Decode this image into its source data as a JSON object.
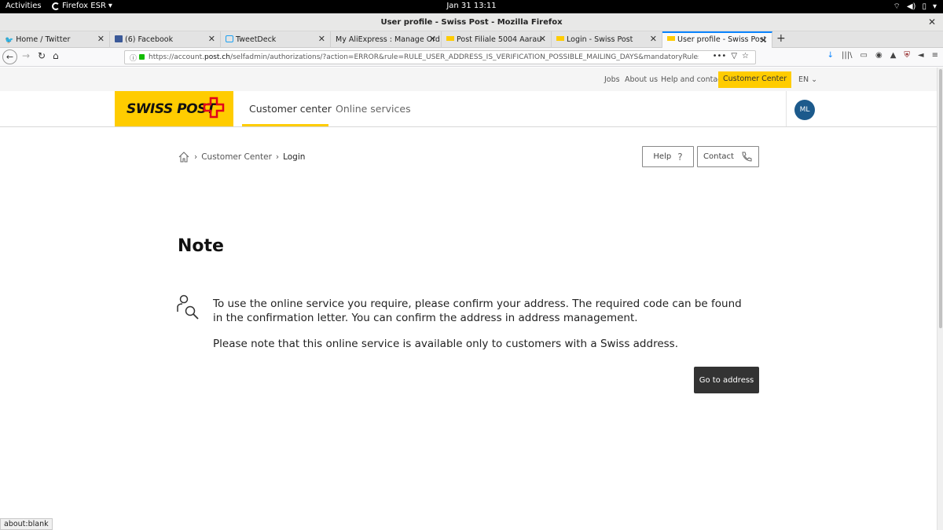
{
  "gnome": {
    "activities": "Activities",
    "app": "Firefox ESR",
    "clock": "Jan 31  13:11"
  },
  "window": {
    "title": "User profile - Swiss Post - Mozilla Firefox"
  },
  "tabs": [
    {
      "label": "Home / Twitter"
    },
    {
      "label": "(6) Facebook"
    },
    {
      "label": "TweetDeck"
    },
    {
      "label": "My AliExpress : Manage Ord"
    },
    {
      "label": "Post Filiale 5004 Aarau"
    },
    {
      "label": "Login - Swiss Post"
    },
    {
      "label": "User profile - Swiss Post"
    }
  ],
  "urlbar": {
    "prefix": "https://account.",
    "domain": "post.ch",
    "rest": "/selfadmin/authorizations/?action=ERROR&rule=RULE_USER_ADDRESS_IS_VERIFICATION_POSSIBLE_MAILING_DAYS&mandatoryRules=RULE"
  },
  "util_nav": {
    "jobs": "Jobs",
    "about": "About us",
    "help_contact": "Help and contact",
    "customer_center": "Customer Center",
    "lang": "EN"
  },
  "main_nav": {
    "logo": "SWISS POST",
    "customer_center": "Customer center",
    "online_services": "Online services",
    "avatar": "ML"
  },
  "breadcrumb": {
    "level1": "Customer Center",
    "current": "Login"
  },
  "actions": {
    "help": "Help",
    "contact": "Contact"
  },
  "content": {
    "title": "Note",
    "message1": "To use the online service you require, please confirm your address. The required code can be found in the confirmation letter. You can confirm the address in address management.",
    "message2": "Please note that this online service is available only to customers with a Swiss address.",
    "button": "Go to address"
  },
  "statusbar": "about:blank",
  "colors": {
    "brand_yellow": "#ffcc00",
    "avatar_blue": "#1c5a8c",
    "button_dark": "#333333"
  }
}
